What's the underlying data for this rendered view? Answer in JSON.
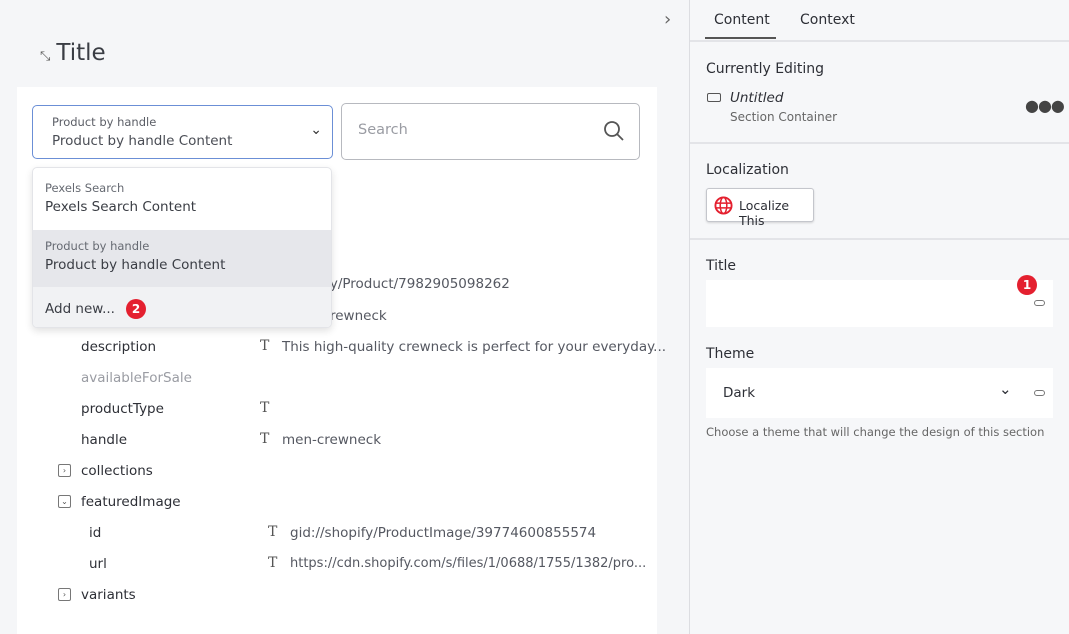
{
  "header": {
    "title": "Title",
    "collapse_icon": "chevron-right-icon"
  },
  "source_select": {
    "label": "Product by handle",
    "value": "Product by handle Content"
  },
  "search": {
    "placeholder": "Search"
  },
  "dropdown": {
    "options": [
      {
        "label": "Pexels Search",
        "value": "Pexels Search Content"
      },
      {
        "label": "Product by handle",
        "value": "Product by handle Content",
        "selected": true
      }
    ],
    "add_new": "Add new...",
    "add_new_badge": "2"
  },
  "tree": {
    "hidden_rows": [
      {
        "value": "pify/Product/7982905098262"
      },
      {
        "value": "rewneck"
      }
    ],
    "rows": [
      {
        "name": "description",
        "type": "T",
        "value": "This high-quality crewneck is perfect for your everyday..."
      },
      {
        "name": "availableForSale",
        "type": "",
        "value": ""
      },
      {
        "name": "productType",
        "type": "T",
        "value": ""
      },
      {
        "name": "handle",
        "type": "T",
        "value": "men-crewneck"
      },
      {
        "name": "collections",
        "expander": "collapsed"
      },
      {
        "name": "featuredImage",
        "expander": "expanded"
      },
      {
        "name": "id",
        "type": "T",
        "value": "gid://shopify/ProductImage/39774600855574"
      },
      {
        "name": "url",
        "type": "T",
        "value": "https://cdn.shopify.com/s/files/1/0688/1755/1382/pro..."
      },
      {
        "name": "variants",
        "expander": "collapsed"
      }
    ]
  },
  "panel": {
    "tabs": [
      "Content",
      "Context"
    ],
    "active_tab": "Content",
    "editing": {
      "heading": "Currently Editing",
      "name": "Untitled",
      "type": "Section Container"
    },
    "localization": {
      "heading": "Localization",
      "button": "Localize This"
    },
    "title_field": {
      "label": "Title",
      "value": "",
      "badge": "1"
    },
    "theme_field": {
      "label": "Theme",
      "value": "Dark",
      "help": "Choose a theme that will change the design of this section"
    }
  },
  "colors": {
    "badge": "#e4202f",
    "focus": "#6b8fd6"
  }
}
